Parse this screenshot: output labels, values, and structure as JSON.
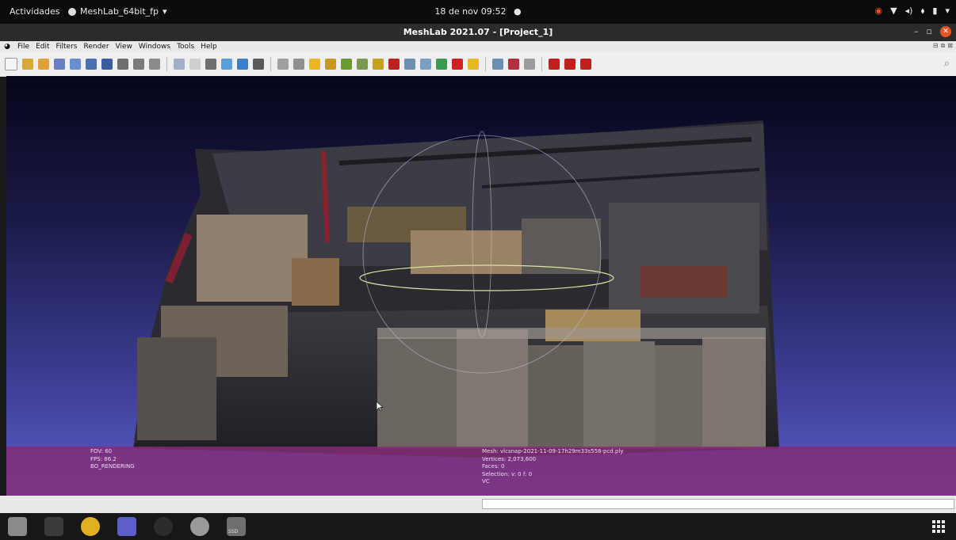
{
  "topbar": {
    "activities": "Actividades",
    "app_name": "MeshLab_64bit_fp",
    "clock": "18 de nov 09:52",
    "recording_indicator": "●"
  },
  "window": {
    "title": "MeshLab 2021.07 - [Project_1]",
    "minimize": "–",
    "maximize": "▫",
    "close": "✕"
  },
  "menu": {
    "items": [
      "File",
      "Edit",
      "Filters",
      "Render",
      "View",
      "Windows",
      "Tools",
      "Help"
    ]
  },
  "toolbar": {
    "tool_colors": [
      "#f4f4f4",
      "#d7a83a",
      "#e0a13a",
      "#6a7fbf",
      "#6a8fcf",
      "#4a6fb0",
      "#3a5d9f",
      "#6e6e6e",
      "#7a7a7a",
      "#8a8a8a",
      "#9fb0c8",
      "#cfcfcf",
      "#6e6e6e",
      "#5a9fd7",
      "#3a7fc7",
      "#5a5a5a",
      "#a0a0a0",
      "#909090",
      "#e9b820",
      "#c89820",
      "#6a9a30",
      "#7a9a50",
      "#c8a020",
      "#c02020",
      "#6a8fb0",
      "#7a9fc0",
      "#3a9a50",
      "#d02020",
      "#e9b820",
      "#6a8fb0",
      "#b03040",
      "#9a9aa0",
      "#c02020",
      "#c02020",
      "#c02020"
    ]
  },
  "viewport": {
    "info_left": [
      "FOV: 60",
      "FPS:  86.2",
      "BO_RENDERING"
    ],
    "info_mid": [
      "Mesh: vlcsnap-2021-11-09-17h29m33s558-pcd.ply",
      "Vertices: 2,073,600",
      "Faces: 0",
      "Selection: v: 0 f: 0",
      "VC"
    ]
  },
  "colors": {
    "viewport_top": "#05051a",
    "viewport_bottom": "#5c5cc8",
    "infobar": "#842c76",
    "dock_bg": "#171717"
  },
  "dock": {
    "items": [
      {
        "name": "files-icon",
        "color": "#8a8a8a"
      },
      {
        "name": "terminal-icon",
        "color": "#3a3a3a"
      },
      {
        "name": "chrome-icon",
        "color": "#e0b020"
      },
      {
        "name": "teams-icon",
        "color": "#5b5fc7"
      },
      {
        "name": "obs-icon",
        "color": "#2b2b2b"
      },
      {
        "name": "meshlab-icon",
        "color": "#9a9a9a"
      },
      {
        "name": "ssd-drive-icon",
        "color": "#6f6f6f"
      }
    ],
    "ssd_label": "SSD",
    "app_grid": "⠿"
  }
}
